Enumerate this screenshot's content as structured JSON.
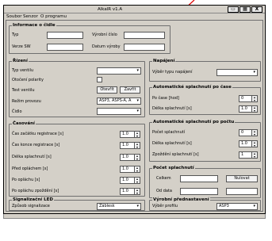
{
  "window": {
    "title": "AlkalR v1.A",
    "buttons": [
      "▭",
      "▦",
      "X"
    ]
  },
  "menu": [
    "Soubor",
    "Senzor",
    "O programu"
  ],
  "info": {
    "title": "Informace o čidle",
    "typ_label": "Typ",
    "verze_label": "Verze SW",
    "vyrobni_label": "Výrobní číslo",
    "datum_label": "Datum výroby"
  },
  "rizeni": {
    "title": "Řízení",
    "typ_ventilu_label": "Typ ventilu",
    "otoceni_label": "Otočení polarity",
    "test_label": "Test ventilu",
    "otevrit_label": "Otevřít",
    "zavrit_label": "Zavřít",
    "rezim_label": "Režim provozu",
    "rezim_value": "ASP3, ASPS-A, A",
    "cidlo_label": "Čidlo",
    "caret": "▾"
  },
  "napajeni": {
    "title": "Napájení",
    "vyber_label": "Výběr typu napájení"
  },
  "auto_cas": {
    "title": "Automatické splachnutí po čase",
    "po_case_label": "Po čase [hod]",
    "po_case_value": "0",
    "delka_label": "Délka splachnutí [s]",
    "delka_value": "1.0"
  },
  "casovani": {
    "title": "Časování",
    "rows": [
      {
        "label": "Čas začátku registrace [s]",
        "value": "1.0"
      },
      {
        "label": "Čas konce registrace [s]",
        "value": "1.0"
      },
      {
        "label": "Délka splachnutí [s]",
        "value": "1.0"
      },
      {
        "label": "Před opláchem [s]",
        "value": "1.0"
      },
      {
        "label": "Po opláchu [s]",
        "value": "1.0"
      },
      {
        "label": "Po opláchu zpoždění [s]",
        "value": "1.0"
      }
    ]
  },
  "auto_pocet": {
    "title": "Automatické splachnutí po počtu",
    "pocet_label": "Počet splachnutí",
    "pocet_value": "0",
    "delka_label": "Délka splachnutí [s]",
    "delka_value": "1.0",
    "zpozdeni_label": "Zpoždění splachnutí [s]",
    "zpozdeni_value": "1"
  },
  "pocet_splachnuti": {
    "title": "Počet splachnutí",
    "celkem_label": "Celkem",
    "nulovat_label": "Nulovat",
    "od_data_label": "Od data"
  },
  "led": {
    "title": "Signalizační LED",
    "zpusob_label": "Způsob signalizace",
    "zpusob_value": "Záblesk"
  },
  "vyrobni": {
    "title": "Výrobní přednastavení",
    "vyber_label": "Výběr profilu",
    "vyber_value": "ASP3"
  }
}
